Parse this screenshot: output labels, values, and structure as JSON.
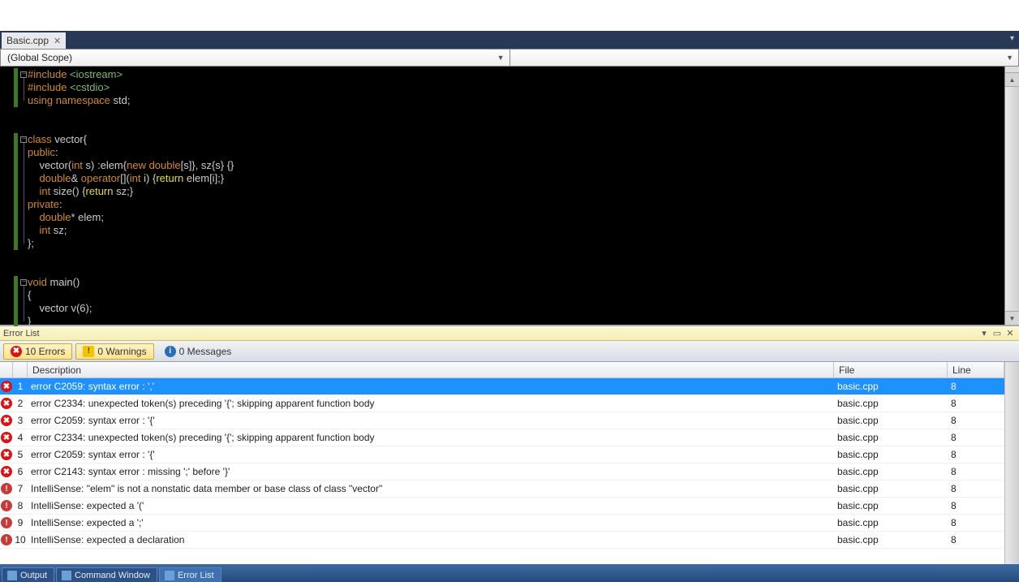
{
  "tabs": {
    "active": "Basic.cpp"
  },
  "scope": {
    "left": "(Global Scope)",
    "right": ""
  },
  "code_lines": [
    [
      {
        "c": "dir",
        "t": "#include "
      },
      {
        "c": "str",
        "t": "<iostream>"
      }
    ],
    [
      {
        "c": "dir",
        "t": "#include "
      },
      {
        "c": "str",
        "t": "<cstdio>"
      }
    ],
    [
      {
        "c": "kw",
        "t": "using "
      },
      {
        "c": "kw",
        "t": "namespace "
      },
      {
        "c": "pun",
        "t": "std;"
      }
    ],
    [],
    [],
    [
      {
        "c": "kw",
        "t": "class "
      },
      {
        "c": "pun",
        "t": "vector{"
      }
    ],
    [
      {
        "c": "kw",
        "t": "public"
      },
      {
        "c": "pun",
        "t": ":"
      }
    ],
    [
      {
        "c": "pun",
        "t": "    vector("
      },
      {
        "c": "kw",
        "t": "int"
      },
      {
        "c": "pun",
        "t": " s) :elem{"
      },
      {
        "c": "kw",
        "t": "new "
      },
      {
        "c": "kw",
        "t": "double"
      },
      {
        "c": "pun",
        "t": "[s]}, sz{s} {}"
      }
    ],
    [
      {
        "c": "pun",
        "t": "    "
      },
      {
        "c": "kw",
        "t": "double"
      },
      {
        "c": "pun",
        "t": "& "
      },
      {
        "c": "kw",
        "t": "operator"
      },
      {
        "c": "pun",
        "t": "[]("
      },
      {
        "c": "kw",
        "t": "int"
      },
      {
        "c": "pun",
        "t": " i) {"
      },
      {
        "c": "ret",
        "t": "return"
      },
      {
        "c": "pun",
        "t": " elem[i];}"
      }
    ],
    [
      {
        "c": "pun",
        "t": "    "
      },
      {
        "c": "kw",
        "t": "int"
      },
      {
        "c": "pun",
        "t": " size() {"
      },
      {
        "c": "ret",
        "t": "return"
      },
      {
        "c": "pun",
        "t": " sz;}"
      }
    ],
    [
      {
        "c": "kw",
        "t": "private"
      },
      {
        "c": "pun",
        "t": ":"
      }
    ],
    [
      {
        "c": "pun",
        "t": "    "
      },
      {
        "c": "kw",
        "t": "double"
      },
      {
        "c": "pun",
        "t": "* elem;"
      }
    ],
    [
      {
        "c": "pun",
        "t": "    "
      },
      {
        "c": "kw",
        "t": "int"
      },
      {
        "c": "pun",
        "t": " sz;"
      }
    ],
    [
      {
        "c": "pun",
        "t": "};"
      }
    ],
    [],
    [],
    [
      {
        "c": "kw",
        "t": "void"
      },
      {
        "c": "pun",
        "t": " main()"
      }
    ],
    [
      {
        "c": "pun",
        "t": "{"
      }
    ],
    [
      {
        "c": "pun",
        "t": "    vector v(6);"
      }
    ],
    [
      {
        "c": "pun",
        "t": "}"
      }
    ]
  ],
  "errorlist": {
    "title": "Error List",
    "filters": {
      "errors": "10 Errors",
      "warnings": "0 Warnings",
      "messages": "0 Messages"
    },
    "columns": {
      "desc": "Description",
      "file": "File",
      "line": "Line"
    },
    "rows": [
      {
        "ico": "err",
        "n": "1",
        "desc": "error C2059: syntax error : ','",
        "file": "basic.cpp",
        "line": "8",
        "sel": true
      },
      {
        "ico": "err",
        "n": "2",
        "desc": "error C2334: unexpected token(s) preceding '{'; skipping apparent function body",
        "file": "basic.cpp",
        "line": "8"
      },
      {
        "ico": "err",
        "n": "3",
        "desc": "error C2059: syntax error : '{'",
        "file": "basic.cpp",
        "line": "8"
      },
      {
        "ico": "err",
        "n": "4",
        "desc": "error C2334: unexpected token(s) preceding '{'; skipping apparent function body",
        "file": "basic.cpp",
        "line": "8"
      },
      {
        "ico": "err",
        "n": "5",
        "desc": "error C2059: syntax error : '{'",
        "file": "basic.cpp",
        "line": "8"
      },
      {
        "ico": "err",
        "n": "6",
        "desc": "error C2143: syntax error : missing ';' before '}'",
        "file": "basic.cpp",
        "line": "8"
      },
      {
        "ico": "is",
        "n": "7",
        "desc": "IntelliSense: \"elem\" is not a nonstatic data member or base class of class \"vector\"",
        "file": "basic.cpp",
        "line": "8"
      },
      {
        "ico": "is",
        "n": "8",
        "desc": "IntelliSense: expected a '('",
        "file": "basic.cpp",
        "line": "8"
      },
      {
        "ico": "is",
        "n": "9",
        "desc": "IntelliSense: expected a ';'",
        "file": "basic.cpp",
        "line": "8"
      },
      {
        "ico": "is",
        "n": "10",
        "desc": "IntelliSense: expected a declaration",
        "file": "basic.cpp",
        "line": "8"
      }
    ]
  },
  "bottom_tabs": [
    "Output",
    "Command Window",
    "Error List"
  ]
}
